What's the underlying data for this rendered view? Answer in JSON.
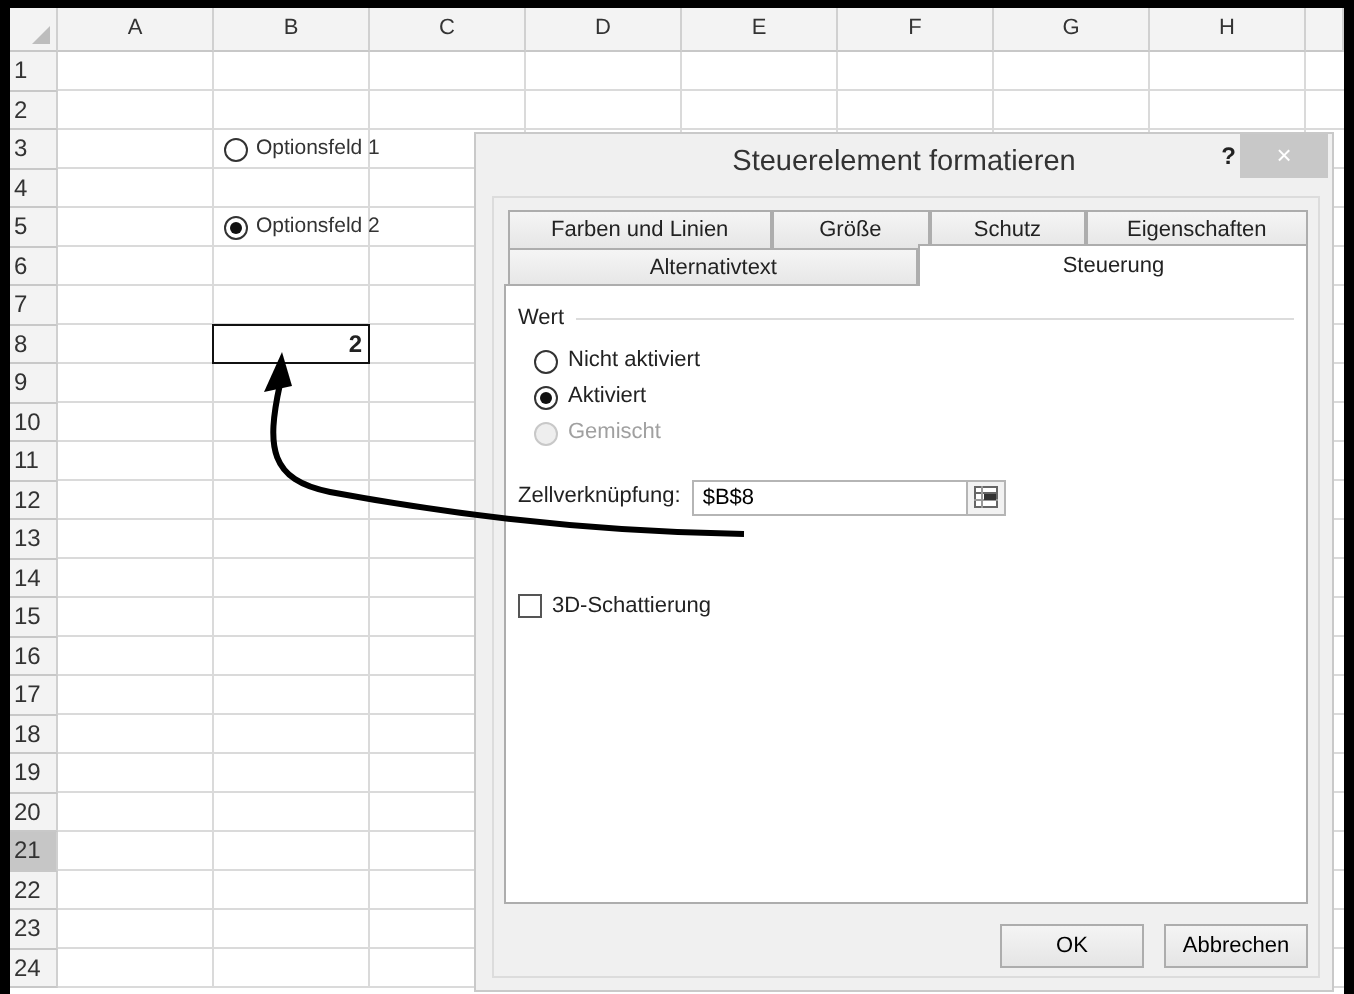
{
  "sheet": {
    "columns": [
      "A",
      "B",
      "C",
      "D",
      "E",
      "F",
      "G",
      "H"
    ],
    "rows": [
      {
        "label": "1",
        "selected": false
      },
      {
        "label": "2",
        "selected": false
      },
      {
        "label": "3",
        "selected": false
      },
      {
        "label": "4",
        "selected": false
      },
      {
        "label": "5",
        "selected": false
      },
      {
        "label": "6",
        "selected": false
      },
      {
        "label": "7",
        "selected": false
      },
      {
        "label": "8",
        "selected": false
      },
      {
        "label": "9",
        "selected": false
      },
      {
        "label": "10",
        "selected": false
      },
      {
        "label": "11",
        "selected": false
      },
      {
        "label": "12",
        "selected": false
      },
      {
        "label": "13",
        "selected": false
      },
      {
        "label": "14",
        "selected": false
      },
      {
        "label": "15",
        "selected": false
      },
      {
        "label": "16",
        "selected": false
      },
      {
        "label": "17",
        "selected": false
      },
      {
        "label": "18",
        "selected": false
      },
      {
        "label": "19",
        "selected": false
      },
      {
        "label": "20",
        "selected": false
      },
      {
        "label": "21",
        "selected": true
      },
      {
        "label": "22",
        "selected": false
      },
      {
        "label": "23",
        "selected": false
      },
      {
        "label": "24",
        "selected": false
      }
    ],
    "option_buttons": [
      {
        "label": "Optionsfeld 1",
        "checked": false
      },
      {
        "label": "Optionsfeld 2",
        "checked": true
      }
    ],
    "linked_cell": {
      "value": "2"
    }
  },
  "dialog": {
    "title": "Steuerelement formatieren",
    "help": "?",
    "close": "×",
    "tab_rows": [
      {
        "tabs": [
          {
            "label": "Farben und Linien",
            "selected": false
          },
          {
            "label": "Größe",
            "selected": false
          },
          {
            "label": "Schutz",
            "selected": false
          },
          {
            "label": "Eigenschaften",
            "selected": false
          }
        ]
      },
      {
        "tabs": [
          {
            "label": "Alternativtext",
            "selected": false
          },
          {
            "label": "Steuerung",
            "selected": true
          }
        ]
      }
    ],
    "group_label": "Wert",
    "radios": [
      {
        "label": "Nicht aktiviert",
        "checked": false,
        "disabled": false
      },
      {
        "label": "Aktiviert",
        "checked": true,
        "disabled": false
      },
      {
        "label": "Gemischt",
        "checked": false,
        "disabled": true
      }
    ],
    "cell_link": {
      "label": "Zellverknüpfung:",
      "value": "$B$8"
    },
    "shading": {
      "label": "3D-Schattierung",
      "checked": false
    },
    "buttons": [
      "OK",
      "Abbrechen"
    ]
  }
}
